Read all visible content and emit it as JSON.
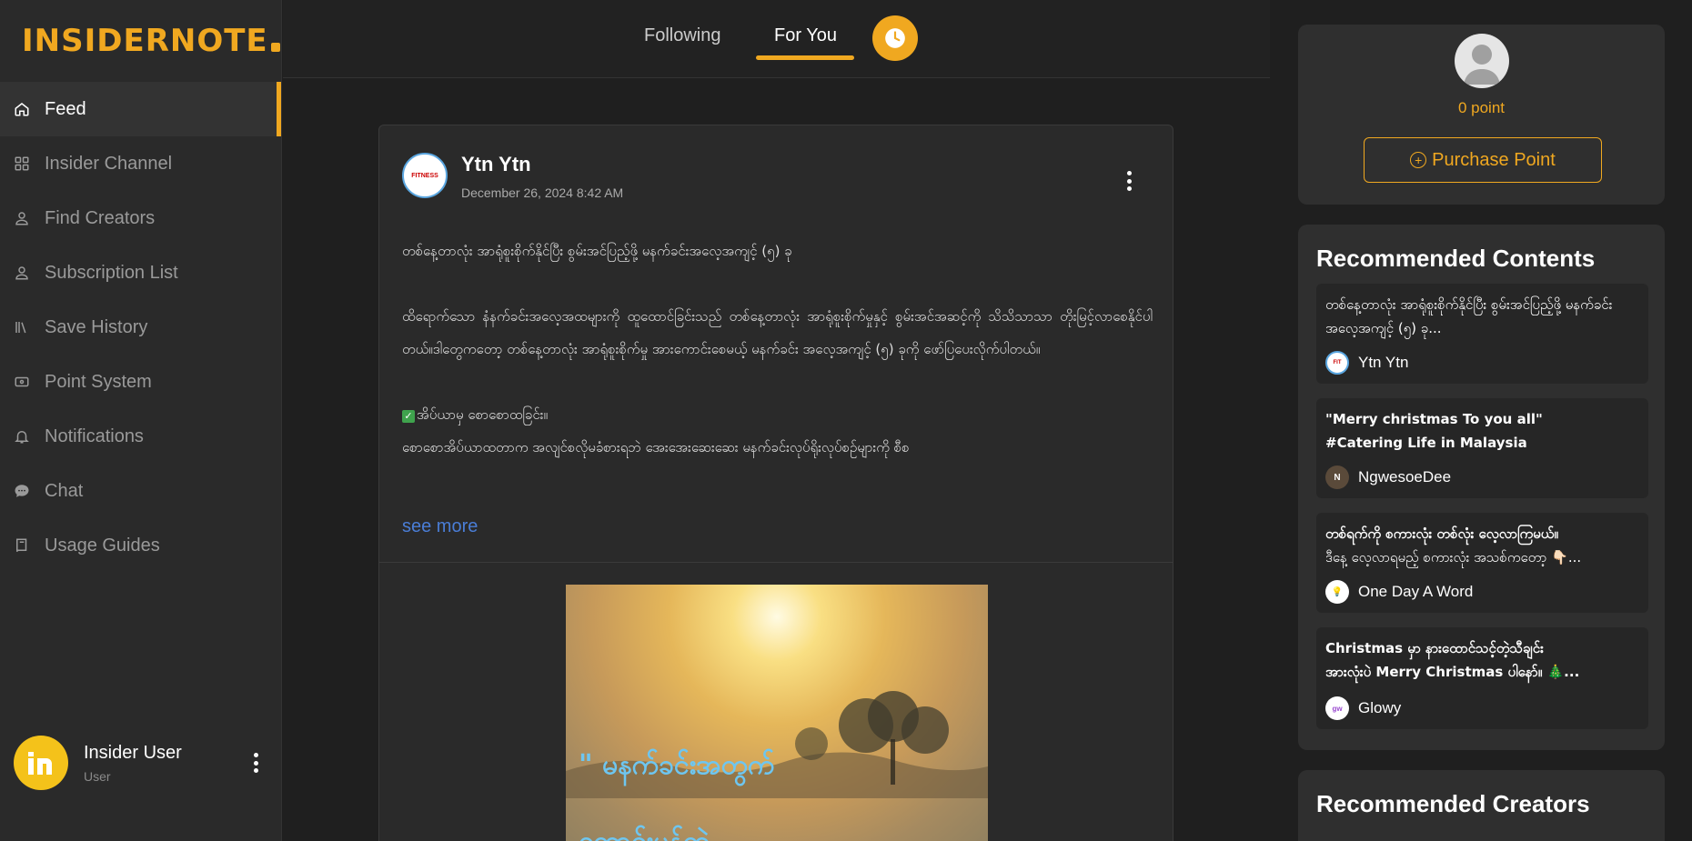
{
  "brand": {
    "name": "INSIDERNOTE",
    "accent": "#f0a820"
  },
  "sidebar": {
    "items": [
      {
        "label": "Feed",
        "icon": "home-icon",
        "active": true
      },
      {
        "label": "Insider Channel",
        "icon": "grid-icon"
      },
      {
        "label": "Find Creators",
        "icon": "person-icon"
      },
      {
        "label": "Subscription List",
        "icon": "person-icon"
      },
      {
        "label": "Save History",
        "icon": "library-icon"
      },
      {
        "label": "Point System",
        "icon": "ticket-icon"
      },
      {
        "label": "Notifications",
        "icon": "bell-icon"
      },
      {
        "label": "Chat",
        "icon": "chat-icon"
      },
      {
        "label": "Usage Guides",
        "icon": "book-icon"
      }
    ],
    "user": {
      "name": "Insider User",
      "role": "User"
    }
  },
  "tabs": {
    "following": "Following",
    "for_you": "For You",
    "active": "For You"
  },
  "post": {
    "author": "Ytn Ytn",
    "date": "December 26, 2024 8:42 AM",
    "avatar_text": "FITNESS",
    "lines": [
      "တစ်နေ့တာလုံး အာရုံစူးစိုက်နိုင်ပြီး စွမ်းအင်ပြည့်ဖို့ မနက်ခင်းအလေ့အကျင့် (၅) ခု",
      "ထိရောက်သော နံနက်ခင်းအလေ့အထများကို ထူထောင်ခြင်းသည် တစ်နေ့တာလုံး အာရုံစူးစိုက်မှုနှင့် စွမ်းအင်အဆင့်ကို သိသိသာသာ တိုးမြင့်လာစေနိုင်ပါတယ်။ဒါတွေကတော့ တစ်နေ့တာလုံး အာရုံစူးစိုက်မှု အားကောင်းစေမယ့် မနက်ခင်း အလေ့အကျင့် (၅) ခုကို ဖော်ပြပေးလိုက်ပါတယ်။",
      "အိပ်ယာမှ စောစောထခြင်း။",
      "စောစောအိပ်ယာထတာက အလျင်စလိုမခံစားရဘဲ အေးအေးဆေးဆေး မနက်ခင်းလုပ်ရိုးလုပ်စဉ်များကို စီစ"
    ],
    "see_more": "see more",
    "image_text_1": "\" မနက်ခင်းအတွက်",
    "image_text_2": "တောင်းမွန်တဲ့"
  },
  "right_panel": {
    "points": "0 point",
    "purchase_label": "Purchase Point",
    "recommended_contents_title": "Recommended Contents",
    "recommended": [
      {
        "text": "တစ်နေ့တာလုံး အာရုံစူးစိုက်နိုင်ပြီး စွမ်းအင်ပြည့်ဖို့ မနက်ခင်းအလေ့အကျင့် (၅) ခု...",
        "author": "Ytn Ytn",
        "bold": false
      },
      {
        "text_1": "\"Merry christmas To you all\"",
        "text_2": "#Catering Life in Malaysia",
        "author": "NgwesoeDee",
        "bold": true
      },
      {
        "text_1": "တစ်ရက်ကို စကားလုံး တစ်လုံး လေ့လာကြမယ်။",
        "text_2": "ဒီနေ့ လေ့လာရမည့် စကားလုံး အသစ်ကတော့ 👇🏻...",
        "author": "One Day A Word",
        "bold": true
      },
      {
        "text_1": "Christmas မှာ နားထောင်သင့်တဲ့သီချင်း",
        "text_2": "အားလုံးပဲ Merry Christmas ပါနော်။ 🎄...",
        "author": "Glowy",
        "bold": true
      }
    ],
    "recommended_creators_title": "Recommended Creators"
  }
}
